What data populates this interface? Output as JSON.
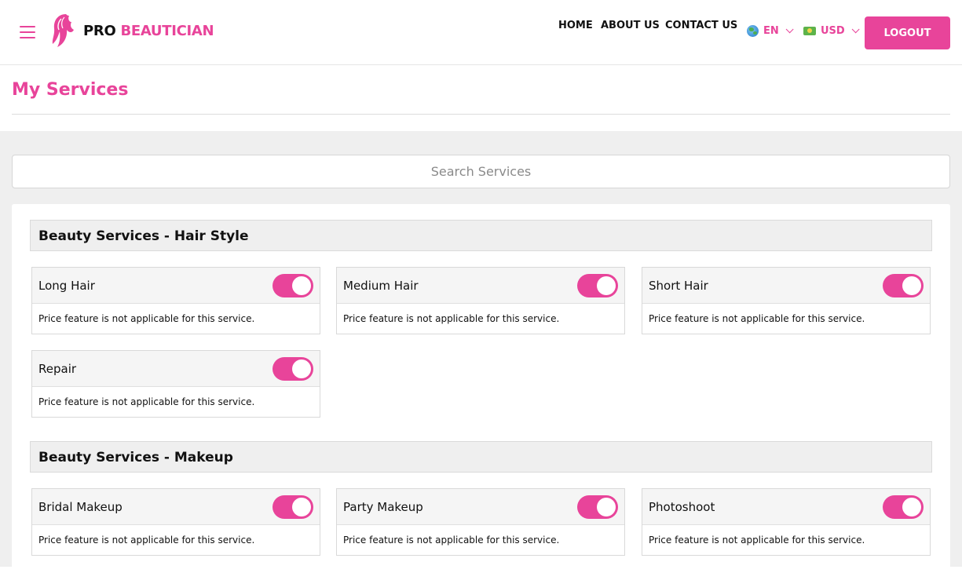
{
  "brand": {
    "pro": "PRO",
    "name": "BEAUTICIAN"
  },
  "nav": {
    "home": "HOME",
    "about": "ABOUT US",
    "contact": "CONTACT US"
  },
  "language": {
    "value": "EN",
    "icon": "globe-icon"
  },
  "currency": {
    "value": "USD",
    "icon": "money-icon"
  },
  "logout_label": "LOGOUT",
  "page_title": "My Services",
  "search": {
    "placeholder": "Search Services",
    "value": ""
  },
  "colors": {
    "accent": "#e8449a"
  },
  "categories": [
    {
      "title": "Beauty Services - Hair Style",
      "services": [
        {
          "name": "Long Hair",
          "note": "Price feature is not applicable for this service.",
          "enabled": true
        },
        {
          "name": "Medium Hair",
          "note": "Price feature is not applicable for this service.",
          "enabled": true
        },
        {
          "name": "Short Hair",
          "note": "Price feature is not applicable for this service.",
          "enabled": true
        },
        {
          "name": "Repair",
          "note": "Price feature is not applicable for this service.",
          "enabled": true
        }
      ]
    },
    {
      "title": "Beauty Services - Makeup",
      "services": [
        {
          "name": "Bridal Makeup",
          "note": "Price feature is not applicable for this service.",
          "enabled": true
        },
        {
          "name": "Party Makeup",
          "note": "Price feature is not applicable for this service.",
          "enabled": true
        },
        {
          "name": "Photoshoot",
          "note": "Price feature is not applicable for this service.",
          "enabled": true
        }
      ]
    }
  ]
}
